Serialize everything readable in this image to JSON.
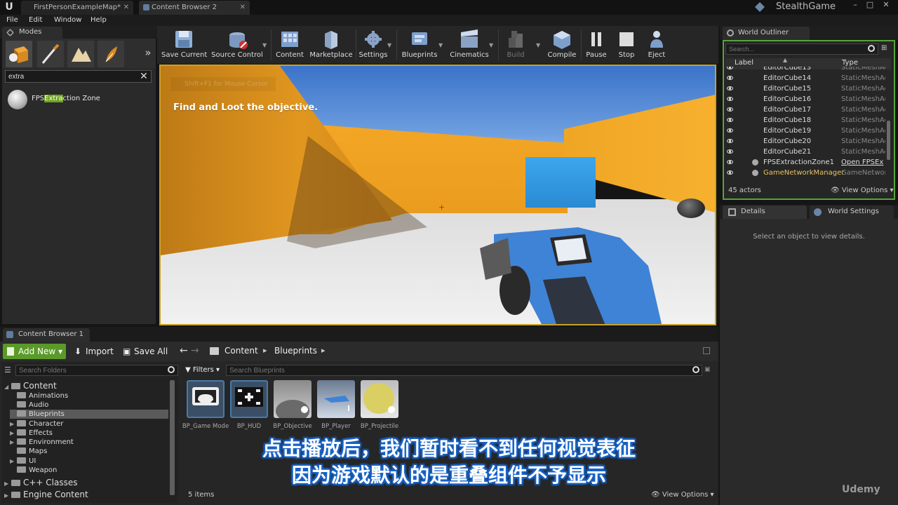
{
  "title_bar": {
    "tabs": [
      "FirstPersonExampleMap*",
      "Content Browser 2"
    ],
    "project": "StealthGame",
    "logo": "U"
  },
  "menu": [
    "File",
    "Edit",
    "Window",
    "Help"
  ],
  "modes": {
    "tab": "Modes",
    "search_value": "extra",
    "result_prefix": "FPS",
    "result_highlight": "Extra",
    "result_suffix": "ction Zone"
  },
  "toolbar": [
    {
      "label": "Save Current",
      "icon": "save-icon"
    },
    {
      "label": "Source Control",
      "icon": "source-control-icon"
    },
    {
      "label": "Content",
      "icon": "content-icon"
    },
    {
      "label": "Marketplace",
      "icon": "marketplace-icon"
    },
    {
      "label": "Settings",
      "icon": "settings-icon"
    },
    {
      "label": "Blueprints",
      "icon": "blueprints-icon"
    },
    {
      "label": "Cinematics",
      "icon": "cinematics-icon"
    },
    {
      "label": "Build",
      "icon": "build-icon"
    },
    {
      "label": "Compile",
      "icon": "compile-icon"
    },
    {
      "label": "Pause",
      "icon": "pause-icon"
    },
    {
      "label": "Stop",
      "icon": "stop-icon"
    },
    {
      "label": "Eject",
      "icon": "eject-icon"
    }
  ],
  "viewport": {
    "hint": "Shift+F1 for Mouse Cursor",
    "objective": "Find and Loot the objective."
  },
  "outliner": {
    "tab": "World Outliner",
    "search_placeholder": "Search...",
    "col_label": "Label",
    "col_type": "Type",
    "rows": [
      {
        "name": "EditorCube13",
        "type": "StaticMeshAc"
      },
      {
        "name": "EditorCube14",
        "type": "StaticMeshAc"
      },
      {
        "name": "EditorCube15",
        "type": "StaticMeshAc"
      },
      {
        "name": "EditorCube16",
        "type": "StaticMeshAc"
      },
      {
        "name": "EditorCube17",
        "type": "StaticMeshAc"
      },
      {
        "name": "EditorCube18",
        "type": "StaticMeshAc"
      },
      {
        "name": "EditorCube19",
        "type": "StaticMeshAc"
      },
      {
        "name": "EditorCube20",
        "type": "StaticMeshAc"
      },
      {
        "name": "EditorCube21",
        "type": "StaticMeshAc"
      },
      {
        "name": "FPSExtractionZone1",
        "type": "Open FPSEx"
      },
      {
        "name": "GameNetworkManager",
        "type": "GameNetwork"
      }
    ],
    "count": "45 actors",
    "view_options": "View Options"
  },
  "details": {
    "tab_details": "Details",
    "tab_world": "World Settings",
    "message": "Select an object to view details."
  },
  "content_browser": {
    "tab": "Content Browser 1",
    "add_new": "Add New",
    "import": "Import",
    "save_all": "Save All",
    "breadcrumb": [
      "Content",
      "Blueprints"
    ],
    "folders_search_placeholder": "Search Folders",
    "assets_search_placeholder": "Search Blueprints",
    "filters": "Filters",
    "folders": [
      {
        "label": "Content",
        "level": 0
      },
      {
        "label": "Animations",
        "level": 1
      },
      {
        "label": "Audio",
        "level": 1
      },
      {
        "label": "Blueprints",
        "level": 1
      },
      {
        "label": "Character",
        "level": 1
      },
      {
        "label": "Effects",
        "level": 1
      },
      {
        "label": "Environment",
        "level": 1
      },
      {
        "label": "Maps",
        "level": 1
      },
      {
        "label": "UI",
        "level": 1
      },
      {
        "label": "Weapon",
        "level": 1
      },
      {
        "label": "C++ Classes",
        "level": 0
      },
      {
        "label": "Engine Content",
        "level": 0
      }
    ],
    "assets": [
      "BP_Game Mode",
      "BP_HUD",
      "BP_Objective",
      "BP_Player",
      "BP_Projectile"
    ],
    "items_count": "5 items",
    "view_options": "View Options"
  },
  "subtitles": [
    "点击播放后，我们暂时看不到任何视觉表征",
    "因为游戏默认的是重叠组件不予显示"
  ],
  "watermark": "Udemy",
  "colors": {
    "viewport_border": "#c9a227",
    "outliner_border": "#55a43d",
    "add_new": "#5a9a28",
    "highlight": "#6fa21d",
    "subtitle_outline": "#1a66cc"
  }
}
